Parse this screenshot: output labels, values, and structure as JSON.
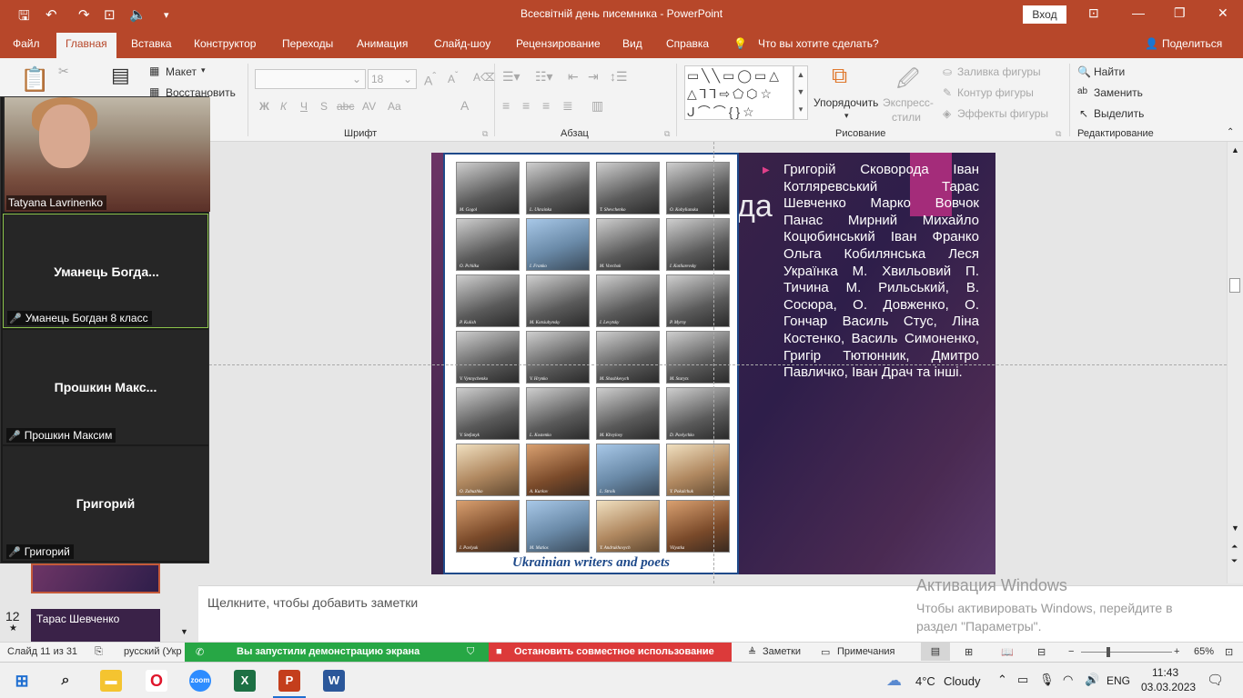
{
  "window": {
    "title": "Всесвітній день писемника - PowerPoint",
    "login_label": "Вход"
  },
  "tabs": [
    {
      "label": "Файл"
    },
    {
      "label": "Главная"
    },
    {
      "label": "Вставка"
    },
    {
      "label": "Конструктор"
    },
    {
      "label": "Переходы"
    },
    {
      "label": "Анимация"
    },
    {
      "label": "Слайд-шоу"
    },
    {
      "label": "Рецензирование"
    },
    {
      "label": "Вид"
    },
    {
      "label": "Справка"
    }
  ],
  "tell_me": "Что вы хотите сделать?",
  "share_label": "Поделиться",
  "ribbon": {
    "slides": {
      "layout": "Макет",
      "reset": "Восстановить"
    },
    "font": {
      "label": "Шрифт",
      "size": "18",
      "buttons": [
        "Ж",
        "К",
        "Ч",
        "S",
        "abc",
        "AV",
        "Aa",
        "A"
      ]
    },
    "paragraph": {
      "label": "Абзац"
    },
    "drawing": {
      "label": "Рисование",
      "arrange": "Упорядочить",
      "quick_styles_1": "Экспресс-",
      "quick_styles_2": "стили",
      "fill": "Заливка фигуры",
      "outline": "Контур фигуры",
      "effects": "Эффекты фигуры"
    },
    "editing": {
      "label": "Редактирование",
      "find": "Найти",
      "replace": "Заменить",
      "select": "Выделить"
    }
  },
  "slide": {
    "partial_title": "да",
    "poster_caption": "Ukrainian writers and poets",
    "photo_captions": [
      "M. Gogol",
      "L. Ukrainka",
      "T. Shevchenko",
      "O. Kobylianska",
      "O. Pchilka",
      "I. Franko",
      "M. Vovchok",
      "I. Kotliarevsky",
      "P. Kulish",
      "M. Kotsiubynsky",
      "I. Levytsky",
      "P. Myrny",
      "V. Vynnychenko",
      "V. Hrynko",
      "M. Shashkevych",
      "M. Staryts",
      "V. Stefanyk",
      "L. Kostenko",
      "M. Khvylovy",
      "D. Pavlychko",
      "O. Zabuzhko",
      "A. Kurkov",
      "L. Stroik",
      "Y. Pokalchuk",
      "I. Pavlyuk",
      "M. Matios",
      "Y. Andrukhovych",
      "Vilyatka"
    ],
    "body_text": "Григорій Сковорода Іван Котляревський Тарас Шевченко Марко Вовчок Панас Мирний Михайло Коцюбинський Іван Франко Ольга Кобилянська Леся Українка М. Хвильовий П. Тичина М. Рильський, В. Сосюра, О. Довженко, О. Гончар Василь Стус, Ліна Костенко, Василь Симоненко, Григір Тютюнник, Дмитро Павличко, Іван Драч та інші."
  },
  "notes_placeholder": "Щелкните, чтобы добавить заметки",
  "activation": {
    "title": "Активация Windows",
    "subtitle": "Чтобы активировать Windows, перейдите в раздел \"Параметры\"."
  },
  "thumbnails": {
    "next_number": "12",
    "next_title": "Тарас Шевченко"
  },
  "zoom": {
    "participants": [
      {
        "name": "Tatyana Lavrinenko",
        "display": "",
        "muted": false
      },
      {
        "name": "Уманець Богдан 8 класс",
        "display": "Уманець Богда...",
        "muted": true
      },
      {
        "name": "Прошкин Максим",
        "display": "Прошкин Макс...",
        "muted": true
      },
      {
        "name": "Григорий",
        "display": "Григорий",
        "muted": true
      }
    ]
  },
  "statusbar": {
    "slide_counter": "Слайд 11 из 31",
    "language": "русский (Укр",
    "sharing_message": "Вы запустили демонстрацию экрана",
    "stop_sharing": "Остановить совместное использование",
    "notes_btn": "Заметки",
    "comments_btn": "Примечания",
    "zoom_level": "65%"
  },
  "taskbar": {
    "weather_temp": "4°C",
    "weather_desc": "Cloudy",
    "lang": "ENG",
    "time": "11:43",
    "date": "03.03.2023"
  },
  "colors": {
    "accent": "#b7472a",
    "zoom_active": "#8bc34a",
    "share_green": "#27a745",
    "share_red": "#dc3a3a"
  }
}
